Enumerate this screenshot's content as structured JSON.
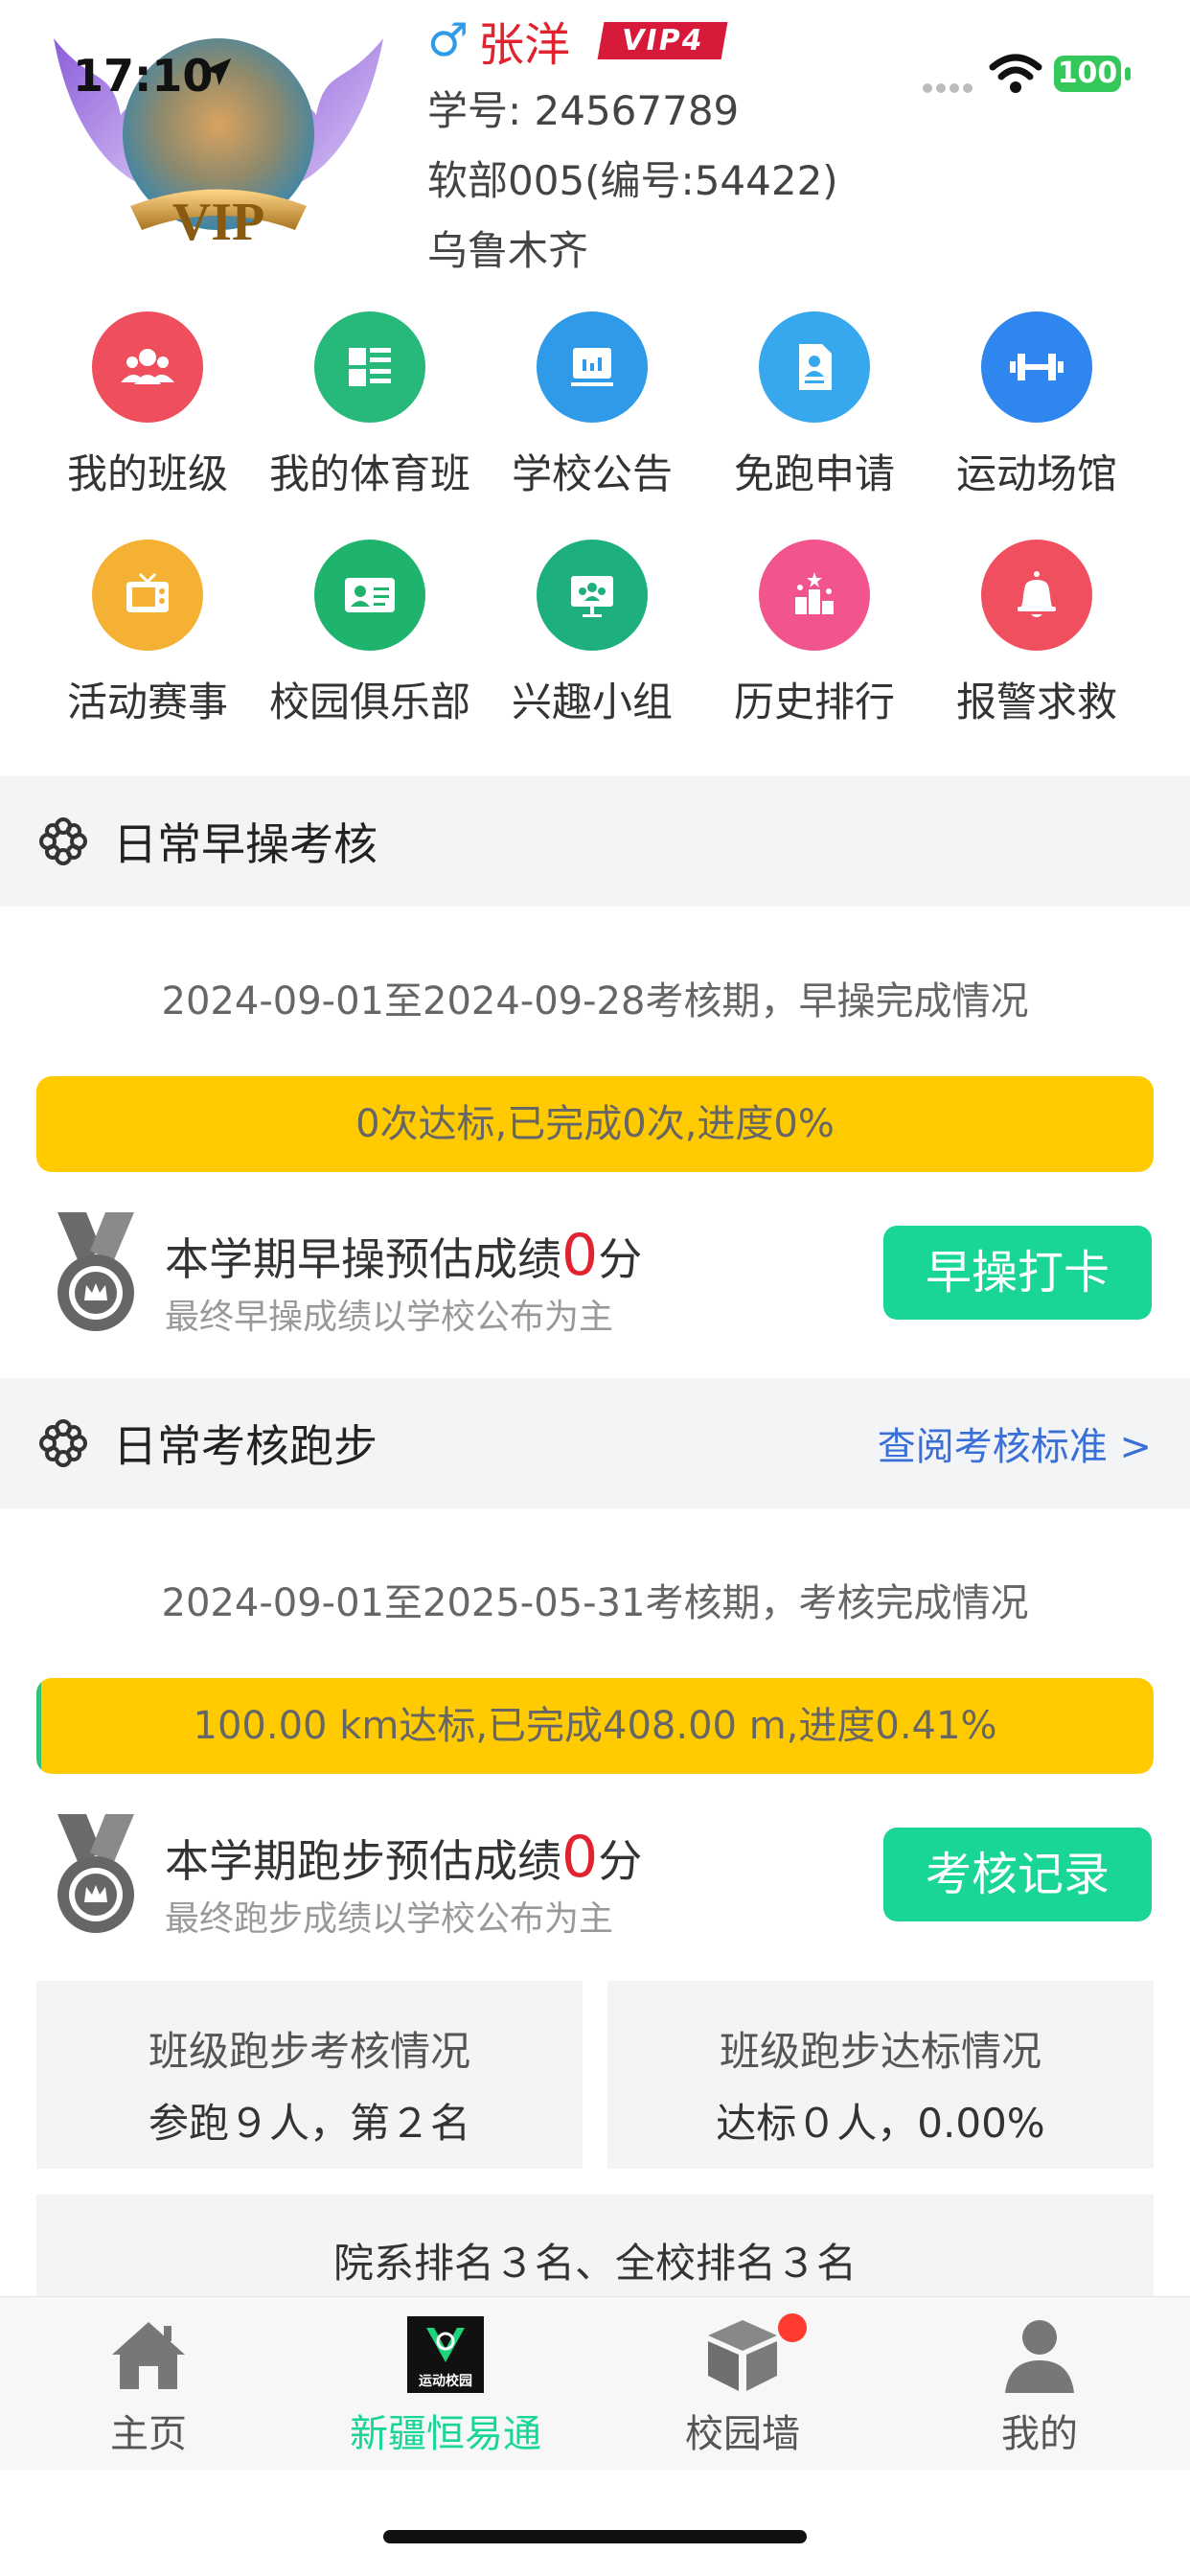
{
  "status": {
    "time": "17:10",
    "battery": "100"
  },
  "profile": {
    "gender_symbol": "♂",
    "name": "张洋",
    "vip": "VIP4",
    "student_id": "学号: 24567789",
    "class": "软部005(编号:54422)",
    "city": "乌鲁木齐",
    "avatar_text": "VIP"
  },
  "grid": [
    {
      "label": "我的班级",
      "color": "#ef4f5d",
      "icon": "group-icon"
    },
    {
      "label": "我的体育班",
      "color": "#27b97a",
      "icon": "list-icon"
    },
    {
      "label": "学校公告",
      "color": "#2f9be8",
      "icon": "board-icon"
    },
    {
      "label": "免跑申请",
      "color": "#38a8ee",
      "icon": "document-icon"
    },
    {
      "label": "运动场馆",
      "color": "#2f86ee",
      "icon": "dumbbell-icon"
    },
    {
      "label": "活动赛事",
      "color": "#f5b133",
      "icon": "tv-icon"
    },
    {
      "label": "校园俱乐部",
      "color": "#1fb46e",
      "icon": "id-card-icon"
    },
    {
      "label": "兴趣小组",
      "color": "#1db07e",
      "icon": "presentation-icon"
    },
    {
      "label": "历史排行",
      "color": "#f2558e",
      "icon": "ranking-icon"
    },
    {
      "label": "报警求救",
      "color": "#f04f5f",
      "icon": "bell-icon"
    }
  ],
  "morning": {
    "title": "日常早操考核",
    "period": "2024-09-01至2024-09-28考核期，早操完成情况",
    "progress_text": "0次达标,已完成0次,进度0%",
    "progress": 0,
    "score_prefix": "本学期早操预估成绩",
    "score": "0",
    "score_suffix": "分",
    "note": "最终早操成绩以学校公布为主",
    "button": "早操打卡"
  },
  "running": {
    "title": "日常考核跑步",
    "link": "查阅考核标准 >",
    "period": "2024-09-01至2025-05-31考核期，考核完成情况",
    "progress_text": "100.00 km达标,已完成408.00 m,进度0.41%",
    "progress": 0.0041,
    "score_prefix": "本学期跑步预估成绩",
    "score": "0",
    "score_suffix": "分",
    "note": "最终跑步成绩以学校公布为主",
    "button": "考核记录"
  },
  "stats": {
    "class_exam_title": "班级跑步考核情况",
    "class_exam_value": "参跑９人，第２名",
    "class_std_title": "班级跑步达标情况",
    "class_std_value": "达标０人，0.00%",
    "rank": "院系排名３名、全校排名３名"
  },
  "tabs": [
    {
      "label": "主页",
      "icon": "home-icon"
    },
    {
      "label": "新疆恒易通",
      "icon": "app-logo-icon",
      "logo_text": "运动校园"
    },
    {
      "label": "校园墙",
      "icon": "cube-icon"
    },
    {
      "label": "我的",
      "icon": "person-icon"
    }
  ],
  "colors": {
    "accent": "#19d596",
    "progress_bg": "#ffcb00",
    "score": "#e0232f",
    "link": "#3a6fd8"
  }
}
